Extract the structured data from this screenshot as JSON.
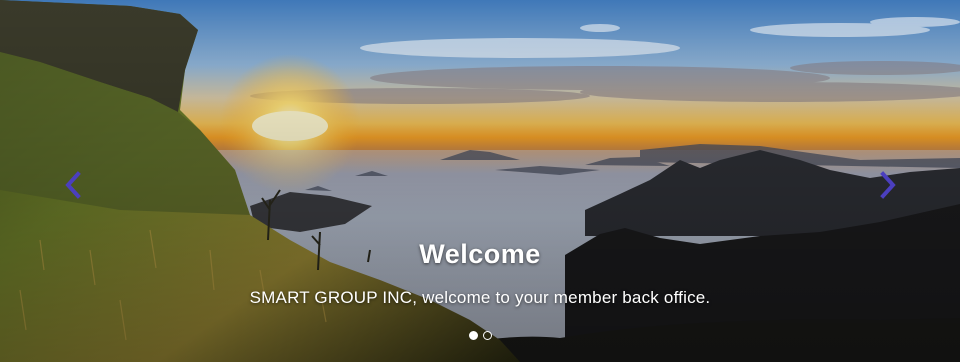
{
  "slide": {
    "title": "Welcome",
    "text": "SMART GROUP INC, welcome to your member back office."
  },
  "controls": {
    "prev_icon": "chevron-left-icon",
    "next_icon": "chevron-right-icon",
    "arrow_color": "#4b3fbf"
  },
  "indicators": {
    "count": 2,
    "active_index": 0
  }
}
